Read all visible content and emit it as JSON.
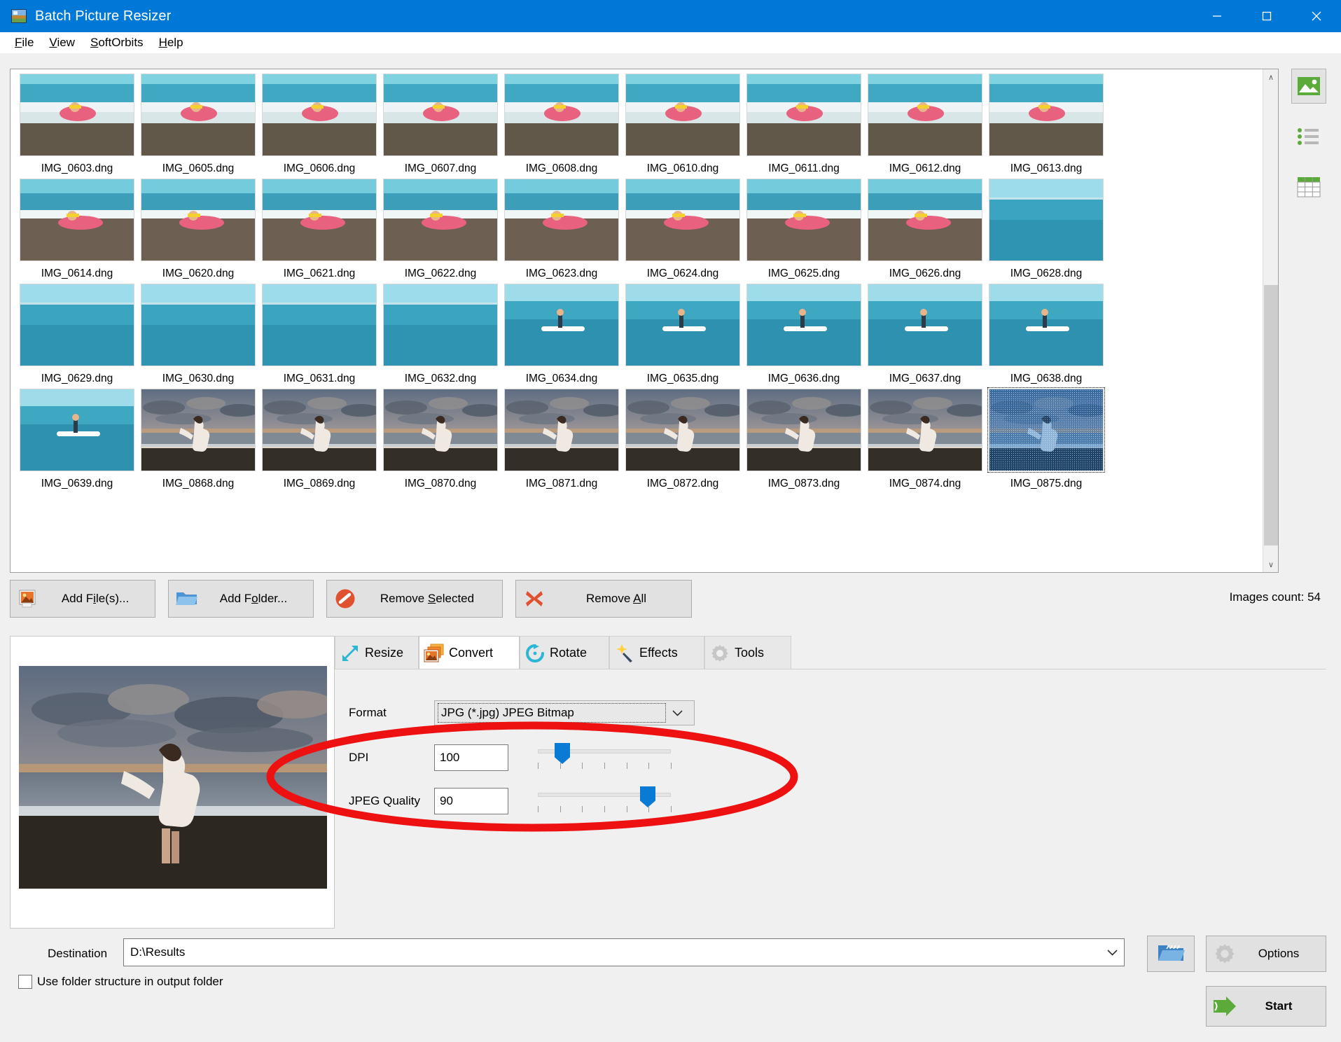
{
  "window": {
    "title": "Batch Picture Resizer",
    "icon": "app-icon",
    "controls": {
      "minimize": "–",
      "maximize": "□",
      "close": "✕"
    }
  },
  "menu": {
    "items": [
      {
        "label": "File",
        "accel": "F"
      },
      {
        "label": "View",
        "accel": "V"
      },
      {
        "label": "SoftOrbits",
        "accel": "S"
      },
      {
        "label": "Help",
        "accel": "H"
      }
    ]
  },
  "thumbnails": {
    "rows": [
      [
        {
          "name": "IMG_0603.dng",
          "scene": "wave-swimmer",
          "selected": false
        },
        {
          "name": "IMG_0605.dng",
          "scene": "wave-swimmer",
          "selected": false
        },
        {
          "name": "IMG_0606.dng",
          "scene": "wave-swimmer",
          "selected": false
        },
        {
          "name": "IMG_0607.dng",
          "scene": "wave-swimmer",
          "selected": false
        },
        {
          "name": "IMG_0608.dng",
          "scene": "wave-swimmer",
          "selected": false
        },
        {
          "name": "IMG_0610.dng",
          "scene": "wave-swimmer",
          "selected": false
        },
        {
          "name": "IMG_0611.dng",
          "scene": "wave-swimmer",
          "selected": false
        },
        {
          "name": "IMG_0612.dng",
          "scene": "wave-swimmer",
          "selected": false
        },
        {
          "name": "IMG_0613.dng",
          "scene": "wave-swimmer",
          "selected": false
        }
      ],
      [
        {
          "name": "IMG_0614.dng",
          "scene": "shore-swimmer",
          "selected": false
        },
        {
          "name": "IMG_0620.dng",
          "scene": "shore-swimmer",
          "selected": false
        },
        {
          "name": "IMG_0621.dng",
          "scene": "shore-swimmer",
          "selected": false
        },
        {
          "name": "IMG_0622.dng",
          "scene": "shore-swimmer",
          "selected": false
        },
        {
          "name": "IMG_0623.dng",
          "scene": "shore-swimmer",
          "selected": false
        },
        {
          "name": "IMG_0624.dng",
          "scene": "shore-swimmer",
          "selected": false
        },
        {
          "name": "IMG_0625.dng",
          "scene": "shore-swimmer",
          "selected": false
        },
        {
          "name": "IMG_0626.dng",
          "scene": "shore-swimmer",
          "selected": false
        },
        {
          "name": "IMG_0628.dng",
          "scene": "open-sea",
          "selected": false
        }
      ],
      [
        {
          "name": "IMG_0629.dng",
          "scene": "open-sea",
          "selected": false
        },
        {
          "name": "IMG_0630.dng",
          "scene": "open-sea",
          "selected": false
        },
        {
          "name": "IMG_0631.dng",
          "scene": "open-sea",
          "selected": false
        },
        {
          "name": "IMG_0632.dng",
          "scene": "open-sea",
          "selected": false
        },
        {
          "name": "IMG_0634.dng",
          "scene": "paddleboard",
          "selected": false
        },
        {
          "name": "IMG_0635.dng",
          "scene": "paddleboard",
          "selected": false
        },
        {
          "name": "IMG_0636.dng",
          "scene": "paddleboard",
          "selected": false
        },
        {
          "name": "IMG_0637.dng",
          "scene": "paddleboard",
          "selected": false
        },
        {
          "name": "IMG_0638.dng",
          "scene": "paddleboard",
          "selected": false
        }
      ],
      [
        {
          "name": "IMG_0639.dng",
          "scene": "paddleboard",
          "selected": false
        },
        {
          "name": "IMG_0868.dng",
          "scene": "sunset-beach",
          "selected": false
        },
        {
          "name": "IMG_0869.dng",
          "scene": "sunset-beach",
          "selected": false
        },
        {
          "name": "IMG_0870.dng",
          "scene": "sunset-beach",
          "selected": false
        },
        {
          "name": "IMG_0871.dng",
          "scene": "sunset-beach",
          "selected": false
        },
        {
          "name": "IMG_0872.dng",
          "scene": "sunset-beach",
          "selected": false
        },
        {
          "name": "IMG_0873.dng",
          "scene": "sunset-beach",
          "selected": false
        },
        {
          "name": "IMG_0874.dng",
          "scene": "sunset-beach",
          "selected": false
        },
        {
          "name": "IMG_0875.dng",
          "scene": "sunset-beach",
          "selected": true
        }
      ]
    ],
    "scroll": {
      "up_arrow": "∧",
      "down_arrow": "∨"
    }
  },
  "view_modes": [
    {
      "name": "thumbnail-view",
      "icon": "image-icon",
      "active": true
    },
    {
      "name": "list-view",
      "icon": "list-icon",
      "active": false
    },
    {
      "name": "table-view",
      "icon": "table-icon",
      "active": false
    }
  ],
  "actions": {
    "add_files": {
      "label": "Add File(s)...",
      "accel": "i",
      "icon": "picture-icon"
    },
    "add_folder": {
      "label": "Add Folder...",
      "accel": "o",
      "icon": "folder-icon"
    },
    "remove_selected": {
      "label": "Remove Selected",
      "accel": "S",
      "icon": "no-entry-icon"
    },
    "remove_all": {
      "label": "Remove All",
      "accel": "A",
      "icon": "red-cross-icon"
    },
    "images_count": "Images count: 54"
  },
  "tabs": [
    {
      "label": "Resize",
      "icon": "resize-arrow-icon",
      "active": false
    },
    {
      "label": "Convert",
      "icon": "convert-images-icon",
      "active": true
    },
    {
      "label": "Rotate",
      "icon": "rotate-icon",
      "active": false
    },
    {
      "label": "Effects",
      "icon": "magic-wand-icon",
      "active": false
    },
    {
      "label": "Tools",
      "icon": "gear-icon",
      "active": false
    }
  ],
  "convert_panel": {
    "format": {
      "label": "Format",
      "value": "JPG (*.jpg) JPEG Bitmap",
      "arrow": "⌄"
    },
    "dpi": {
      "label": "DPI",
      "value": "100",
      "slider_percent": 14,
      "tick_count": 7
    },
    "jpeg_quality": {
      "label": "JPEG Quality",
      "value": "90",
      "slider_percent": 87,
      "tick_count": 7
    }
  },
  "footer": {
    "destination_label": "Destination",
    "destination_value": "D:\\Results",
    "destination_arrow": "⌄",
    "browse_icon": "open-folder-icon",
    "use_folder_structure": {
      "label": "Use folder structure in output folder",
      "checked": false
    },
    "options": {
      "label": "Options",
      "icon": "gear-icon"
    },
    "start": {
      "label": "Start",
      "icon": "green-arrow-icon"
    }
  },
  "annotation": {
    "shape": "red-ellipse-highlight",
    "color": "#ee1111"
  },
  "colors": {
    "titlebar": "#0078d7",
    "accent_slider": "#0a7bd4",
    "start_green": "#5aab3a",
    "annotation_red": "#ee1111"
  }
}
